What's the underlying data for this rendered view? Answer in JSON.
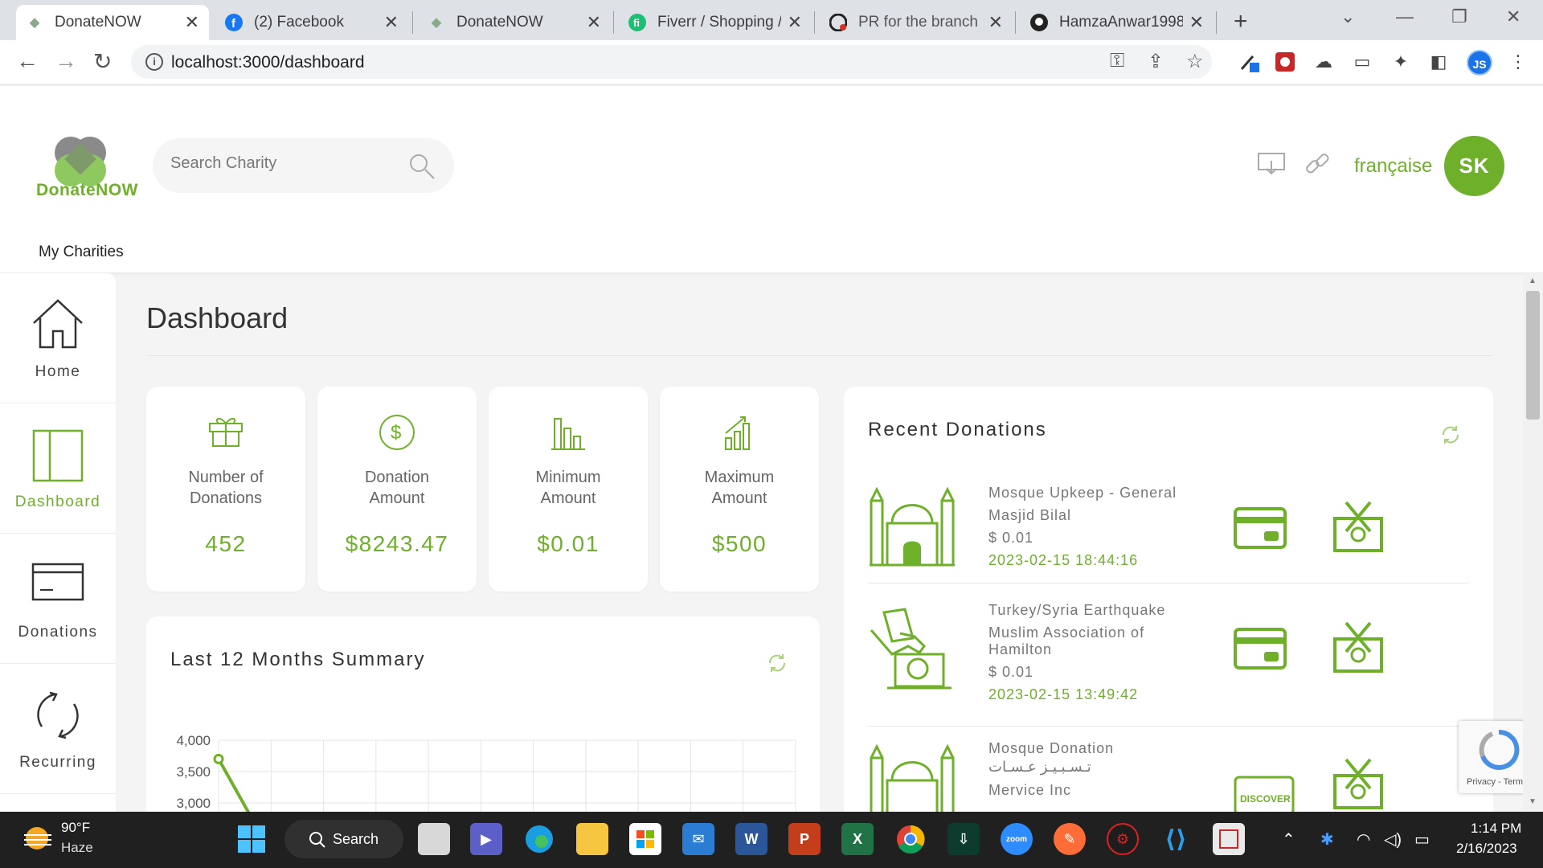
{
  "browser": {
    "tabs": [
      {
        "title": "DonateNOW",
        "active": true
      },
      {
        "title": "(2) Facebook",
        "active": false
      },
      {
        "title": "DonateNOW",
        "active": false
      },
      {
        "title": "Fiverr / Shopping /",
        "active": false
      },
      {
        "title": "PR for the branch (",
        "active": false
      },
      {
        "title": "HamzaAnwar1998/",
        "active": false
      }
    ],
    "url": "localhost:3000/dashboard",
    "profile_initials": "JS"
  },
  "header": {
    "logo_text": "DonateNOW",
    "search_placeholder": "Search Charity",
    "language": "française",
    "user_initials": "SK",
    "nav_label": "My Charities"
  },
  "sidebar": {
    "items": [
      {
        "label": "Home",
        "icon": "home-icon",
        "active": false
      },
      {
        "label": "Dashboard",
        "icon": "dashboard-icon",
        "active": true
      },
      {
        "label": "Donations",
        "icon": "donations-icon",
        "active": false
      },
      {
        "label": "Recurring",
        "icon": "recurring-icon",
        "active": false
      }
    ]
  },
  "page": {
    "title": "Dashboard"
  },
  "stats": [
    {
      "label_line1": "Number of",
      "label_line2": "Donations",
      "value": "452",
      "icon": "gift-icon"
    },
    {
      "label_line1": "Donation",
      "label_line2": "Amount",
      "value": "$8243.47",
      "icon": "dollar-icon"
    },
    {
      "label_line1": "Minimum",
      "label_line2": "Amount",
      "value": "$0.01",
      "icon": "min-chart-icon"
    },
    {
      "label_line1": "Maximum",
      "label_line2": "Amount",
      "value": "$500",
      "icon": "max-chart-icon"
    }
  ],
  "summary": {
    "title": "Last 12 Months Summary",
    "y_ticks": [
      "4,000",
      "3,500",
      "3,000"
    ]
  },
  "chart_data": {
    "type": "line",
    "title": "Last 12 Months Summary",
    "ylim": [
      3000,
      4000
    ],
    "y_ticks": [
      4000,
      3500,
      3000
    ],
    "series": [
      {
        "values": [
          3700,
          3000
        ]
      }
    ]
  },
  "recent": {
    "title": "Recent Donations",
    "rows": [
      {
        "cause": "Mosque Upkeep - General",
        "org": "Masjid Bilal",
        "org2": "",
        "amount": "$ 0.01",
        "date": "2023-02-15 18:44:16",
        "icon": "mosque-icon",
        "payment": "card"
      },
      {
        "cause": "Turkey/Syria Earthquake",
        "org": "Muslim Association of",
        "org2": "Hamilton",
        "amount": "$ 0.01",
        "date": "2023-02-15 13:49:42",
        "icon": "donation-box-icon",
        "payment": "card"
      },
      {
        "cause": "Mosque Donation",
        "org": "تـسـبـيـز عـسـات",
        "org2": "Mervice Inc",
        "amount": "",
        "date": "",
        "icon": "mosque-icon",
        "payment": "DISCOVER"
      }
    ]
  },
  "recaptcha": {
    "footer": "Privacy - Terms"
  },
  "taskbar": {
    "weather_temp": "90°F",
    "weather_desc": "Haze",
    "search_label": "Search",
    "time": "1:14 PM",
    "date": "2/16/2023"
  },
  "colors": {
    "accent": "#6fb02b",
    "taskbar": "#202020"
  }
}
